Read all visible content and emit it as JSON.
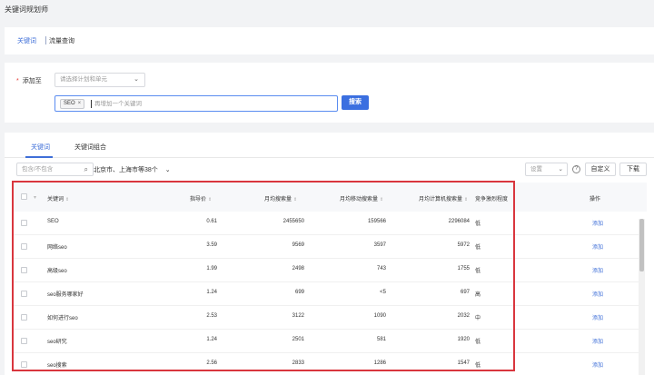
{
  "page": {
    "title": "关键词规划师"
  },
  "top_tabs": [
    {
      "label": "关键词",
      "active": true
    },
    {
      "label": "流量查询",
      "active": false
    }
  ],
  "add_form": {
    "label": "添加至",
    "required_mark": "*",
    "plan_select": {
      "placeholder": "请选择计划和单元"
    },
    "keyword_input": {
      "chips": [
        "SEO"
      ],
      "placeholder": "再增加一个关键词"
    },
    "search_label": "搜索"
  },
  "result_tabs": [
    {
      "label": "关键词",
      "active": true
    },
    {
      "label": "关键词组合",
      "active": false
    }
  ],
  "toolbar": {
    "filter_placeholder": "包含/不包含",
    "region": "北京市、上海市等38个",
    "settings_placeholder": "设置",
    "help": "?",
    "custom_label": "自定义",
    "download_label": "下载"
  },
  "table": {
    "columns": [
      "关键词",
      "指导价",
      "月均搜索量",
      "月均移动搜索量",
      "月均计算机搜索量",
      "竞争激烈程度",
      "操作"
    ],
    "rows": [
      {
        "keyword": "SEO",
        "price": "0.61",
        "monthly": "2455650",
        "mobile": "159566",
        "pc": "2296084",
        "competition": "低",
        "action": "添加"
      },
      {
        "keyword": "网络seo",
        "price": "3.59",
        "monthly": "9569",
        "mobile": "3597",
        "pc": "5972",
        "competition": "低",
        "action": "添加"
      },
      {
        "keyword": "高级seo",
        "price": "1.99",
        "monthly": "2498",
        "mobile": "743",
        "pc": "1755",
        "competition": "低",
        "action": "添加"
      },
      {
        "keyword": "seo服务哪家好",
        "price": "1.24",
        "monthly": "699",
        "mobile": "<5",
        "pc": "697",
        "competition": "高",
        "action": "添加"
      },
      {
        "keyword": "如何进行seo",
        "price": "2.53",
        "monthly": "3122",
        "mobile": "1090",
        "pc": "2032",
        "competition": "中",
        "action": "添加"
      },
      {
        "keyword": "seo研究",
        "price": "1.24",
        "monthly": "2501",
        "mobile": "581",
        "pc": "1920",
        "competition": "低",
        "action": "添加"
      },
      {
        "keyword": "seo搜索",
        "price": "2.56",
        "monthly": "2833",
        "mobile": "1286",
        "pc": "1547",
        "competition": "低",
        "action": "添加"
      }
    ]
  },
  "colors": {
    "accent": "#3b6fe0",
    "highlight_box": "#d9363e"
  }
}
